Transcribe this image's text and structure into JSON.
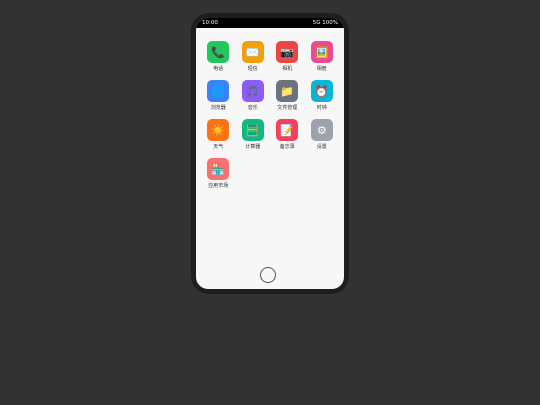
{
  "status_bar": {
    "time": "10:00",
    "network_battery": "5G 100%"
  },
  "apps": [
    {
      "label": "电话",
      "icon": "phone-icon",
      "glyph": "📞",
      "color": "#22c55e"
    },
    {
      "label": "短信",
      "icon": "message-icon",
      "glyph": "✉️",
      "color": "#f59e0b"
    },
    {
      "label": "相机",
      "icon": "camera-icon",
      "glyph": "📷",
      "color": "#ef4444"
    },
    {
      "label": "相册",
      "icon": "gallery-icon",
      "glyph": "🖼️",
      "color": "#ec4899"
    },
    {
      "label": "浏览器",
      "icon": "browser-icon",
      "glyph": "🌐",
      "color": "#3b82f6"
    },
    {
      "label": "音乐",
      "icon": "music-icon",
      "glyph": "🎵",
      "color": "#8b5cf6"
    },
    {
      "label": "文件管理",
      "icon": "folder-icon",
      "glyph": "📁",
      "color": "#6b7280"
    },
    {
      "label": "时钟",
      "icon": "clock-icon",
      "glyph": "⏰",
      "color": "#06b6d4"
    },
    {
      "label": "天气",
      "icon": "weather-icon",
      "glyph": "☀️",
      "color": "#f97316"
    },
    {
      "label": "计算器",
      "icon": "calculator-icon",
      "glyph": "🧮",
      "color": "#10b981"
    },
    {
      "label": "备忘录",
      "icon": "notes-icon",
      "glyph": "📝",
      "color": "#f43f5e"
    },
    {
      "label": "设置",
      "icon": "gear-icon",
      "glyph": "⚙",
      "color": "#9ca3af"
    },
    {
      "label": "应用市场",
      "icon": "app-store-icon",
      "glyph": "🏪",
      "color": "#f87171"
    }
  ]
}
